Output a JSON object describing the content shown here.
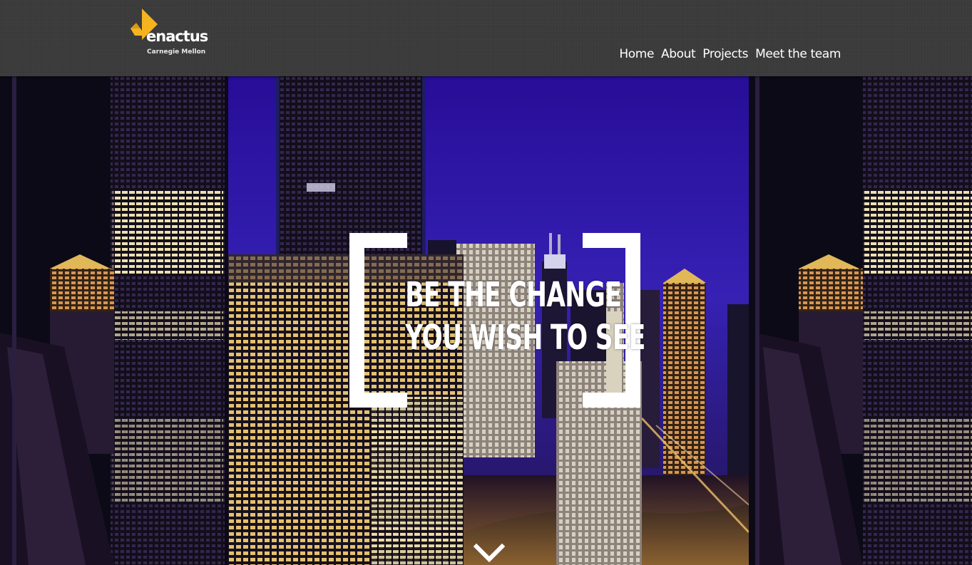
{
  "brand": {
    "logo_word": "enactus",
    "logo_registered": ".",
    "logo_subtitle": "Carnegie Mellon",
    "accent_color": "#f5b320"
  },
  "nav": {
    "items": [
      {
        "label": "Home"
      },
      {
        "label": "About"
      },
      {
        "label": "Projects"
      },
      {
        "label": "Meet the team"
      }
    ]
  },
  "hero": {
    "tagline_line1": "BE THE CHANGE",
    "tagline_line2": "YOU WISH TO SEE",
    "background": "night city skyline photo",
    "scroll_icon": "chevron-down-icon"
  }
}
